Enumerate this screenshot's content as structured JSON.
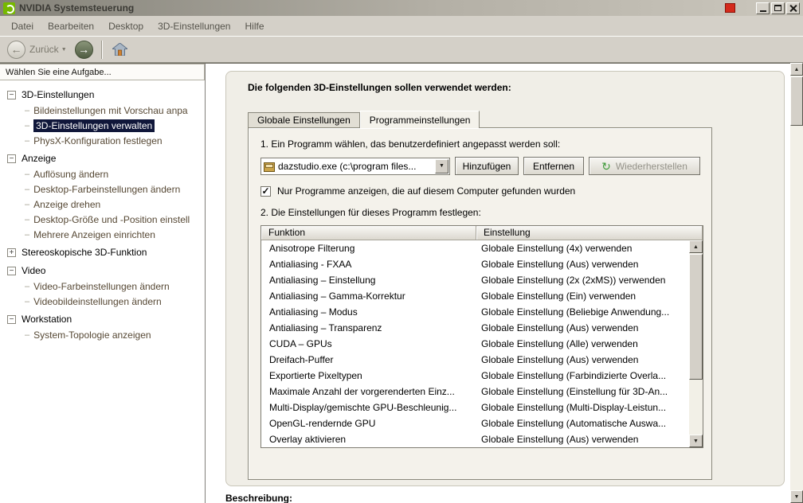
{
  "window": {
    "title": "NVIDIA Systemsteuerung",
    "menu": [
      "Datei",
      "Bearbeiten",
      "Desktop",
      "3D-Einstellungen",
      "Hilfe"
    ]
  },
  "toolbar": {
    "back_label": "Zurück"
  },
  "icons": {
    "back_arrow": "←",
    "forward_arrow": "→",
    "chevron_down": "▼",
    "scroll_up": "▲",
    "scroll_down": "▼",
    "restore": "↻",
    "check": "✓",
    "collapse": "−",
    "expand": "+"
  },
  "colors": {
    "accent_green": "#76b900",
    "selection": "#10173a",
    "chrome": "#d4d0c8"
  },
  "sidebar": {
    "header": "Wählen Sie eine Aufgabe...",
    "tree": [
      {
        "label": "3D-Einstellungen",
        "expanded": true,
        "children": [
          {
            "label": "Bildeinstellungen mit Vorschau anpa"
          },
          {
            "label": "3D-Einstellungen verwalten",
            "selected": true
          },
          {
            "label": "PhysX-Konfiguration festlegen"
          }
        ]
      },
      {
        "label": "Anzeige",
        "expanded": true,
        "children": [
          {
            "label": "Auflösung ändern"
          },
          {
            "label": "Desktop-Farbeinstellungen ändern"
          },
          {
            "label": "Anzeige drehen"
          },
          {
            "label": "Desktop-Größe und -Position einstell"
          },
          {
            "label": "Mehrere Anzeigen einrichten"
          }
        ]
      },
      {
        "label": "Stereoskopische 3D-Funktion",
        "expanded": false,
        "children": []
      },
      {
        "label": "Video",
        "expanded": true,
        "children": [
          {
            "label": "Video-Farbeinstellungen ändern"
          },
          {
            "label": "Videobildeinstellungen ändern"
          }
        ]
      },
      {
        "label": "Workstation",
        "expanded": true,
        "children": [
          {
            "label": "System-Topologie anzeigen"
          }
        ]
      }
    ]
  },
  "main": {
    "heading": "Die folgenden 3D-Einstellungen sollen verwendet werden:",
    "tabs": [
      {
        "label": "Globale Einstellungen",
        "active": false
      },
      {
        "label": "Programmeinstellungen",
        "active": true
      }
    ],
    "step1_label": "1. Ein Programm wählen, das benutzerdefiniert angepasst werden soll:",
    "program_select": {
      "value": "dazstudio.exe (c:\\program files..."
    },
    "buttons": {
      "add": "Hinzufügen",
      "remove": "Entfernen",
      "restore": "Wiederherstellen"
    },
    "show_programs_checkbox": {
      "checked": true,
      "label": "Nur Programme anzeigen, die auf diesem Computer gefunden wurden"
    },
    "step2_label": "2. Die Einstellungen für dieses Programm festlegen:",
    "table": {
      "headers": [
        "Funktion",
        "Einstellung"
      ],
      "rows": [
        [
          "Anisotrope Filterung",
          "Globale Einstellung (4x) verwenden"
        ],
        [
          "Antialiasing - FXAA",
          "Globale Einstellung (Aus) verwenden"
        ],
        [
          "Antialiasing – Einstellung",
          "Globale Einstellung (2x (2xMS)) verwenden"
        ],
        [
          "Antialiasing – Gamma-Korrektur",
          "Globale Einstellung (Ein) verwenden"
        ],
        [
          "Antialiasing – Modus",
          "Globale Einstellung (Beliebige Anwendung..."
        ],
        [
          "Antialiasing – Transparenz",
          "Globale Einstellung (Aus) verwenden"
        ],
        [
          "CUDA – GPUs",
          "Globale Einstellung (Alle) verwenden"
        ],
        [
          "Dreifach-Puffer",
          "Globale Einstellung (Aus) verwenden"
        ],
        [
          "Exportierte Pixeltypen",
          "Globale Einstellung (Farbindizierte Overla..."
        ],
        [
          "Maximale Anzahl der vorgerenderten Einz...",
          "Globale Einstellung (Einstellung für 3D-An..."
        ],
        [
          "Multi-Display/gemischte GPU-Beschleunig...",
          "Globale Einstellung (Multi-Display-Leistun..."
        ],
        [
          "OpenGL-rendernde GPU",
          "Globale Einstellung (Automatische Auswa..."
        ],
        [
          "Overlay aktivieren",
          "Globale Einstellung (Aus) verwenden"
        ]
      ]
    },
    "description_label": "Beschreibung:"
  }
}
